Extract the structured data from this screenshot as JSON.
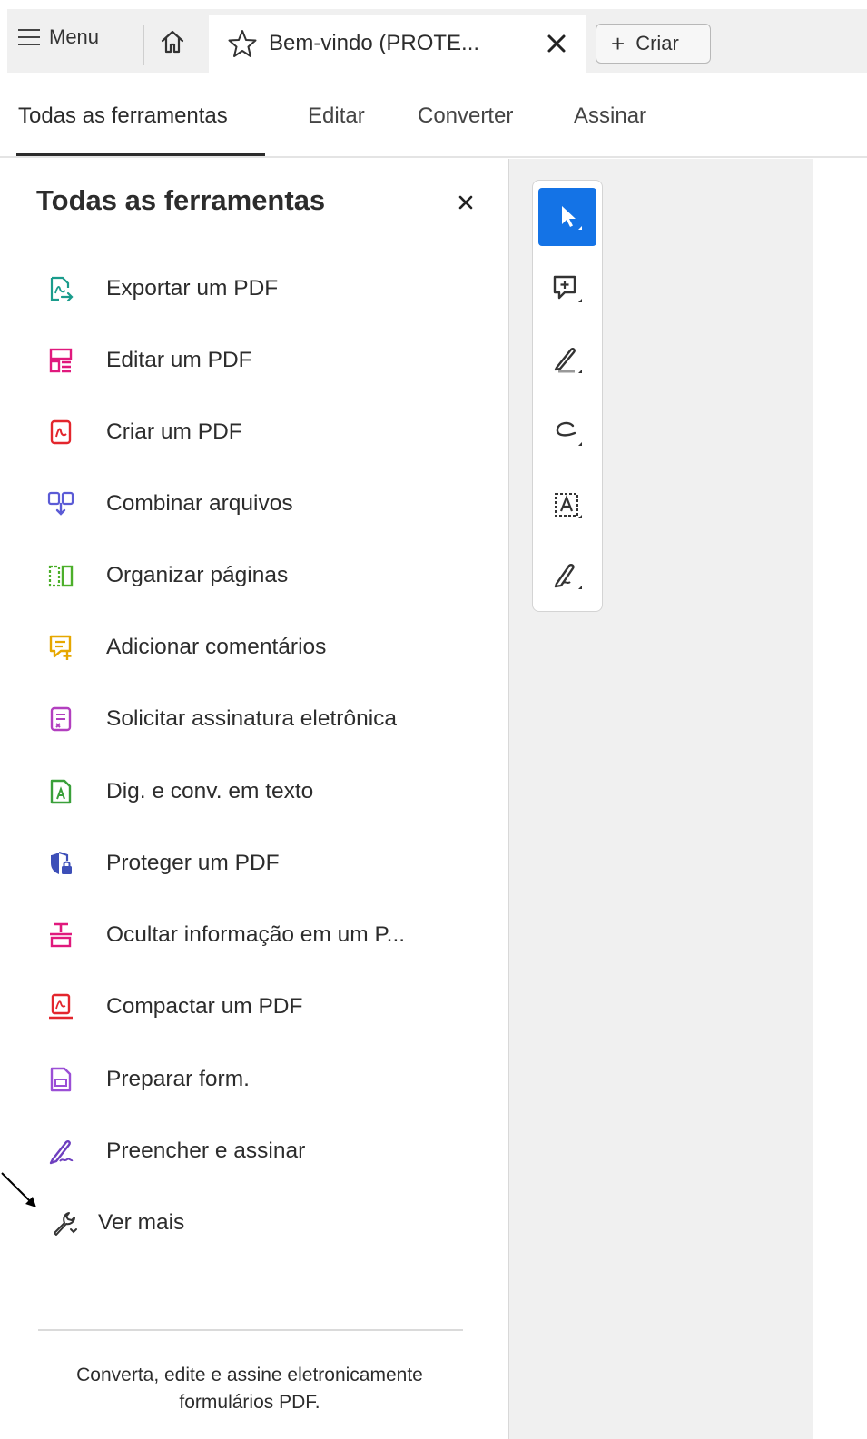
{
  "tabbar": {
    "menu_label": "Menu",
    "menu_icon": "hamburger-icon",
    "home_icon": "home-icon",
    "document_tab_title": "Bem-vindo (PROTE...",
    "favorite_icon": "star-icon",
    "close_tab_icon": "close-icon",
    "create_label": "Criar",
    "create_icon": "plus-icon"
  },
  "nav_tabs": [
    {
      "label": "Todas as ferramentas",
      "active": true
    },
    {
      "label": "Editar",
      "active": false
    },
    {
      "label": "Converter",
      "active": false
    },
    {
      "label": "Assinar",
      "active": false
    }
  ],
  "panel": {
    "title": "Todas as ferramentas",
    "close_icon": "close-icon",
    "tools": [
      {
        "label": "Exportar um PDF",
        "icon": "export-pdf-icon",
        "color": "#1a9c8c"
      },
      {
        "label": "Editar um PDF",
        "icon": "edit-pdf-icon",
        "color": "#e0197d"
      },
      {
        "label": "Criar um PDF",
        "icon": "create-pdf-icon",
        "color": "#e3262d"
      },
      {
        "label": "Combinar arquivos",
        "icon": "combine-files-icon",
        "color": "#5b5bd6"
      },
      {
        "label": "Organizar páginas",
        "icon": "organize-pages-icon",
        "color": "#4caf2a"
      },
      {
        "label": "Adicionar comentários",
        "icon": "add-comment-icon",
        "color": "#e6a700"
      },
      {
        "label": "Solicitar assinatura eletrônica",
        "icon": "request-signature-icon",
        "color": "#b23fbf"
      },
      {
        "label": "Dig. e conv. em texto",
        "icon": "scan-ocr-icon",
        "color": "#3aa03a"
      },
      {
        "label": "Proteger um PDF",
        "icon": "protect-pdf-icon",
        "color": "#3d4fb8"
      },
      {
        "label": "Ocultar informação em um P...",
        "icon": "redact-icon",
        "color": "#e0197d"
      },
      {
        "label": "Compactar um PDF",
        "icon": "compress-pdf-icon",
        "color": "#e3262d"
      },
      {
        "label": "Preparar form.",
        "icon": "prepare-form-icon",
        "color": "#9b4fd6"
      },
      {
        "label": "Preencher e assinar",
        "icon": "fill-sign-icon",
        "color": "#6e3fbf"
      }
    ],
    "see_more_label": "Ver mais",
    "see_more_icon": "wrench-icon",
    "footer_text": "Converta, edite e assine eletronicamente formulários PDF."
  },
  "quick_tools": [
    {
      "icon": "select-cursor-icon",
      "selected": true
    },
    {
      "icon": "add-comment-icon",
      "selected": false
    },
    {
      "icon": "highlight-pen-icon",
      "selected": false
    },
    {
      "icon": "draw-freeform-icon",
      "selected": false
    },
    {
      "icon": "text-select-icon",
      "selected": false
    },
    {
      "icon": "sign-pen-icon",
      "selected": false
    }
  ],
  "colors": {
    "accent": "#1473e6",
    "tabbar_bg": "#f0f0f0",
    "toolbar_bg": "#f0f0f0"
  }
}
